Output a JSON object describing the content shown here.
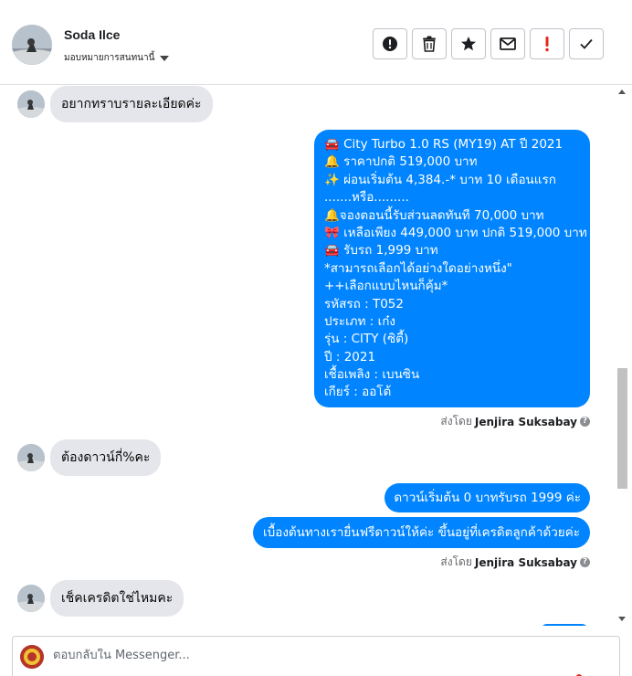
{
  "header": {
    "contact_name": "Soda Ilce",
    "assign_label": "มอบหมายการสนทนานี้",
    "actions": [
      {
        "icon": "alert-circle-icon",
        "label": "mark-as-spam"
      },
      {
        "icon": "trash-icon",
        "label": "delete"
      },
      {
        "icon": "star-icon",
        "label": "star"
      },
      {
        "icon": "envelope-icon",
        "label": "mark-unread"
      },
      {
        "icon": "exclamation-icon",
        "label": "follow-up"
      },
      {
        "icon": "checkmark-icon",
        "label": "done"
      }
    ]
  },
  "thread": {
    "messages": [
      {
        "direction": "in",
        "text": "อยากทราบรายละเอียดค่ะ"
      },
      {
        "direction": "out",
        "lines": [
          "🚘 City Turbo 1.0 RS (MY19) AT ปี 2021",
          "🔔 ราคาปกติ 519,000 บาท",
          "✨  ผ่อนเริ่มต้น 4,384.-* บาท 10 เดือนแรก",
          ".......หรือ.........",
          "🔔จองตอนนี้รับส่วนลดทันที 70,000 บาท",
          "🎀 เหลือเพียง 449,000 บาท ปกติ 519,000 บาท",
          "🚘 รับรถ 1,999 บาท",
          "*สามารถเลือกได้อย่างใดอย่างหนึ่ง\"",
          "++เลือกแบบไหนก็คุ้ม*",
          " รหัสรถ : T052",
          " ประเภท : เก๋ง",
          " รุ่น : CITY (ซิตี้)",
          " ปี : 2021",
          " เชื้อเพลิง : เบนซิน",
          " เกียร์ : ออโต้"
        ]
      },
      {
        "direction": "in",
        "text": "ต้องดาวน์กี่%คะ"
      },
      {
        "direction": "out",
        "text": "ดาวน์เริ่มต้น 0 บาทรับรถ 1999 ค่ะ"
      },
      {
        "direction": "out",
        "text": "เบื้องต้นทางเรายื่นฟรีดาวน์ให้ค่ะ ขึ้นอยู่ที่เครดิตลูกค้าด้วยค่ะ"
      },
      {
        "direction": "in",
        "text": "เช็คเครดิตใช่ไหมคะ"
      }
    ],
    "sent_by_prefix": "ส่งโดย",
    "sent_by_name": "Jenjira Suksabay",
    "help_glyph": "?"
  },
  "composer": {
    "placeholder": "ตอบกลับใน Messenger..."
  },
  "colors": {
    "outgoing_bubble": "#0084ff",
    "incoming_bubble": "#e4e6eb",
    "spam_red": "#e4281f"
  }
}
